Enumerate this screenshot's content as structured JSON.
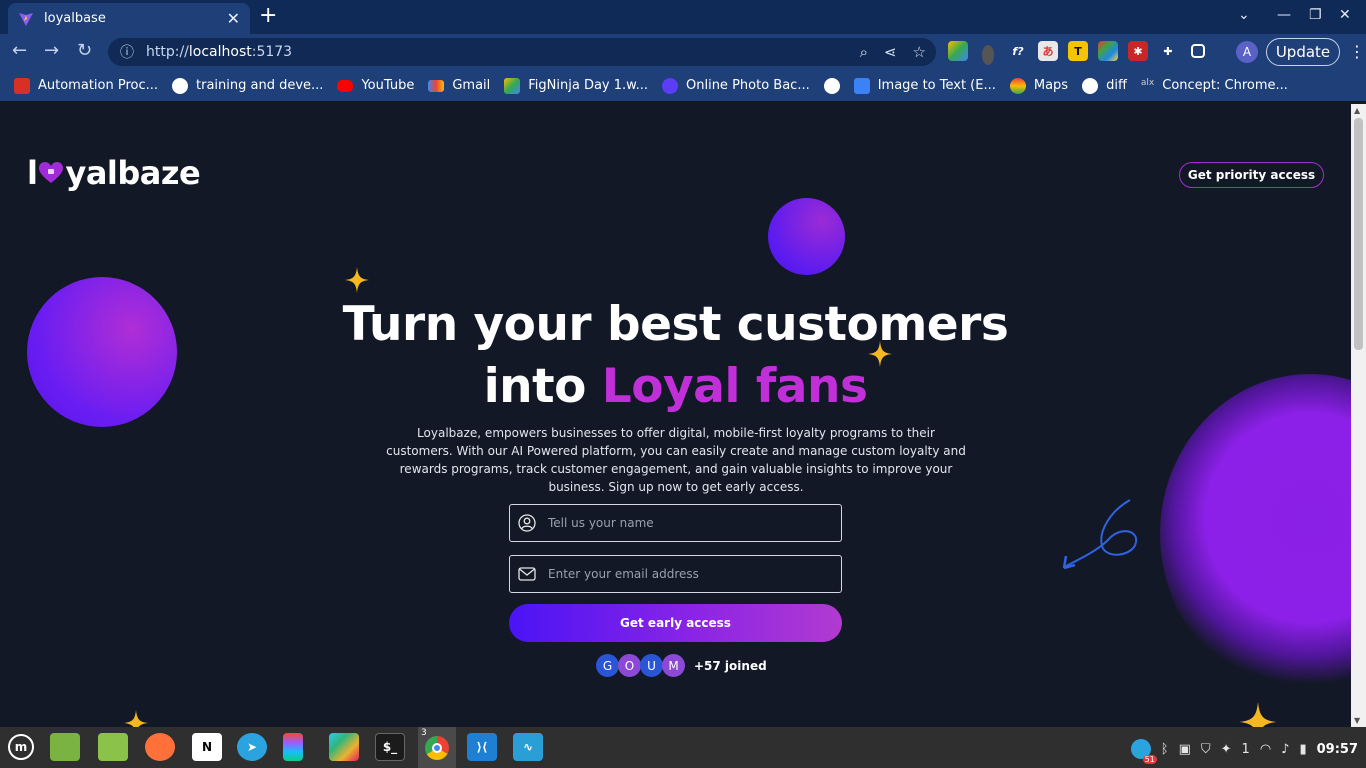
{
  "browser": {
    "tab_title": "loyalbase",
    "tab_close": "✕",
    "new_tab": "+",
    "url_prefix": "http://",
    "url_host": "localhost",
    "url_port": ":5173",
    "update_label": "Update",
    "profile_initial": "A"
  },
  "bookmarks": [
    {
      "label": "Automation Proc...",
      "icon": "gmail-like-icon",
      "color": "#d93025"
    },
    {
      "label": "training and deve...",
      "icon": "globe-icon",
      "color": "#ffffff"
    },
    {
      "label": "YouTube",
      "icon": "youtube-icon",
      "color": "#ff0000"
    },
    {
      "label": "Gmail",
      "icon": "gmail-icon",
      "color": "#ea4335"
    },
    {
      "label": "FigNinja Day 1.w...",
      "icon": "drive-icon",
      "color": "#34a853"
    },
    {
      "label": "Online Photo Bac...",
      "icon": "circle-icon",
      "color": "#5b3df5"
    },
    {
      "label": "",
      "icon": "globe-icon",
      "color": "#ffffff"
    },
    {
      "label": "Image to Text (E...",
      "icon": "scan-icon",
      "color": "#3b82f6"
    },
    {
      "label": "Maps",
      "icon": "maps-icon",
      "color": "#34a853"
    },
    {
      "label": "diff",
      "icon": "globe-icon",
      "color": "#ffffff"
    },
    {
      "label": "Concept: Chrome...",
      "icon": "alx-icon",
      "color": "#cccccc"
    }
  ],
  "site": {
    "logo_left": "l",
    "logo_right": "yalbaze",
    "priority_button": "Get priority access",
    "headline_line1": "Turn your best customers",
    "headline_line2_plain": "into ",
    "headline_line2_accent": "Loyal fans",
    "description": "Loyalbaze, empowers businesses to offer digital, mobile-first loyalty programs to their customers. With our AI Powered platform, you can easily create and manage custom loyalty and rewards programs, track customer engagement, and gain valuable insights to improve your business. Sign up now to get early access.",
    "name_placeholder": "Tell us your name",
    "email_placeholder": "Enter your email address",
    "cta_label": "Get early access",
    "avatars": [
      {
        "letter": "G",
        "color": "#2a55d6"
      },
      {
        "letter": "O",
        "color": "#8c49d8"
      },
      {
        "letter": "U",
        "color": "#2a55d6"
      },
      {
        "letter": "M",
        "color": "#8c49d8"
      }
    ],
    "joined_text": "+57 joined",
    "accent_color": "#c12fd9"
  },
  "taskbar": {
    "chrome_badge": "3",
    "telegram_badge": "51",
    "tray_count": "1",
    "clock": "09:57"
  }
}
